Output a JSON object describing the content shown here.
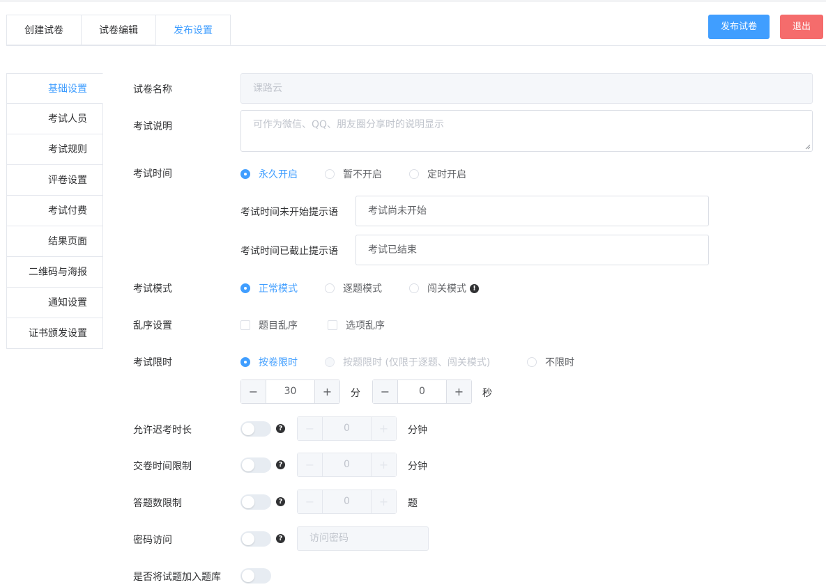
{
  "tabs": [
    "创建试卷",
    "试卷编辑",
    "发布设置"
  ],
  "actions": {
    "publish": "发布试卷",
    "exit": "退出"
  },
  "sidebar": {
    "items": [
      "基础设置",
      "考试人员",
      "考试规则",
      "评卷设置",
      "考试付费",
      "结果页面",
      "二维码与海报",
      "通知设置",
      "证书颁发设置"
    ],
    "active": "基础设置"
  },
  "form": {
    "name": {
      "label": "试卷名称",
      "value": "课路云"
    },
    "desc": {
      "label": "考试说明",
      "placeholder": "可作为微信、QQ、朋友圈分享时的说明显示"
    },
    "time": {
      "label": "考试时间",
      "options": [
        "永久开启",
        "暂不开启",
        "定时开启"
      ],
      "selected": "永久开启",
      "not_started_label": "考试时间未开始提示语",
      "not_started_value": "考试尚未开始",
      "ended_label": "考试时间已截止提示语",
      "ended_value": "考试已结束"
    },
    "mode": {
      "label": "考试模式",
      "options": [
        "正常模式",
        "逐题模式",
        "闯关模式"
      ],
      "selected": "正常模式"
    },
    "shuffle": {
      "label": "乱序设置",
      "options": [
        "题目乱序",
        "选项乱序"
      ]
    },
    "limit": {
      "label": "考试限时",
      "options": [
        "按卷限时",
        "按题限时 (仅限于逐题、闯关模式)",
        "不限时"
      ],
      "selected": "按卷限时",
      "minutes": "30",
      "minutes_unit": "分",
      "seconds": "0",
      "seconds_unit": "秒"
    },
    "late": {
      "label": "允许迟考时长",
      "value": "0",
      "unit": "分钟"
    },
    "submit": {
      "label": "交卷时间限制",
      "value": "0",
      "unit": "分钟"
    },
    "count": {
      "label": "答题数限制",
      "value": "0",
      "unit": "题"
    },
    "password": {
      "label": "密码访问",
      "placeholder": "访问密码"
    },
    "bank": {
      "label": "是否将试题加入题库"
    }
  },
  "icons": {
    "minus": "−",
    "plus": "+",
    "help": "?",
    "info": "!"
  }
}
